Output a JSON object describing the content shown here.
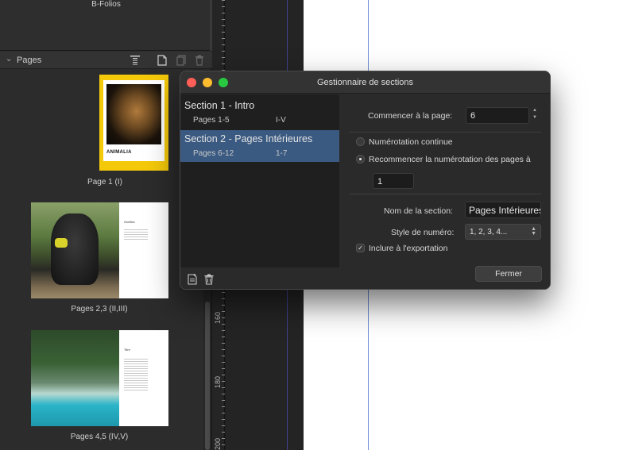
{
  "left_panel": {
    "top_section_label": "B-Folios",
    "pages_title": "Pages",
    "toolbar_icons": [
      "align-top-icon",
      "new-page-icon",
      "duplicate-page-icon",
      "delete-page-icon"
    ],
    "thumbnails": [
      {
        "caption": "Page 1 (I)",
        "cover_title": "ANIMALIA"
      },
      {
        "caption": "Pages 2,3 (II,III)",
        "heading": "Gorilles"
      },
      {
        "caption": "Pages 4,5 (IV,V)",
        "heading": "Titre"
      }
    ]
  },
  "ruler": {
    "labels": [
      "160",
      "180",
      "200"
    ]
  },
  "dialog": {
    "title": "Gestionnaire de sections",
    "sections": [
      {
        "name": "Section 1 - Intro",
        "pages": "Pages 1-5",
        "numbering": "I-V",
        "selected": false
      },
      {
        "name": "Section 2 - Pages Intérieures",
        "pages": "Pages 6-12",
        "numbering": "1-7",
        "selected": true
      }
    ],
    "start_page_label": "Commencer à la page:",
    "start_page_value": "6",
    "continuous_label": "Numérotation continue",
    "restart_label": "Recommencer la numérotation des pages à",
    "restart_value": "1",
    "section_name_label": "Nom de la section:",
    "section_name_value": "Pages Intérieures",
    "number_style_label": "Style de numéro:",
    "number_style_value": "1, 2, 3, 4...",
    "include_export_label": "Inclure à l'exportation",
    "close_label": "Fermer"
  },
  "colors": {
    "accent_selection": "#3a5a82",
    "cover_yellow": "#f4c90a",
    "guide_blue": "#6c8cd8"
  }
}
